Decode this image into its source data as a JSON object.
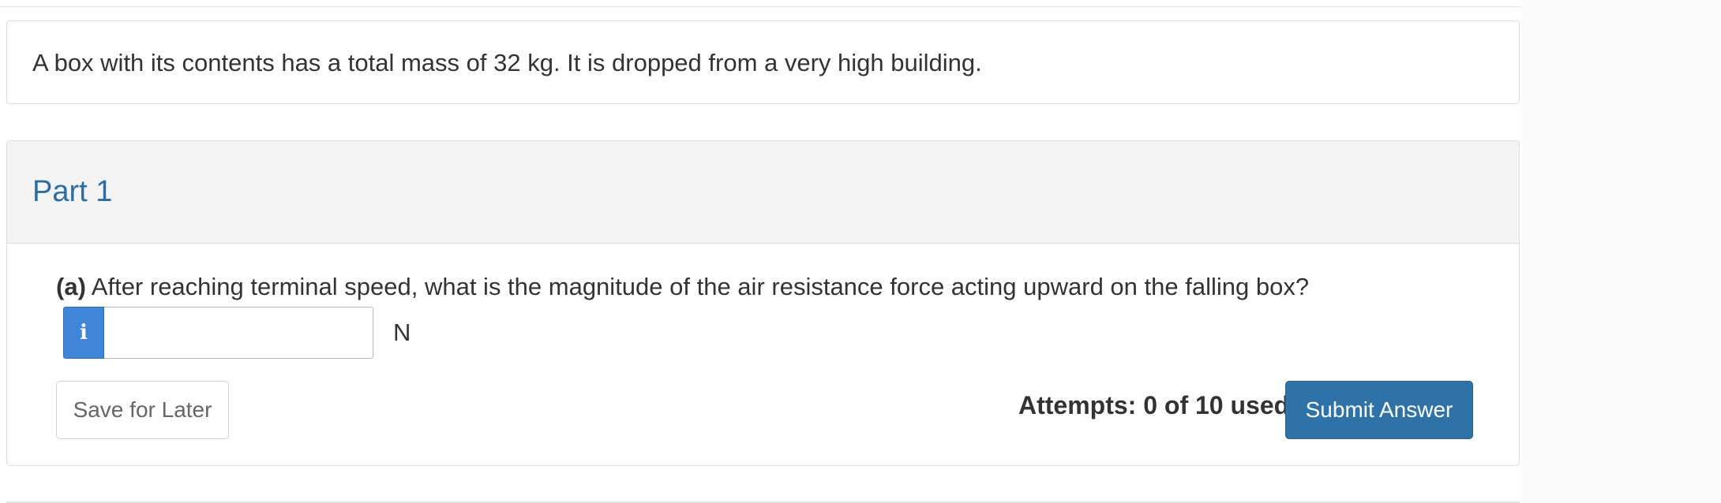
{
  "problem": {
    "stem": "A box with its contents has a total mass of 32 kg. It is dropped from a very high building."
  },
  "part": {
    "title": "Part 1",
    "question_label": "(a)",
    "question_text": " After reaching terminal speed, what is the magnitude of the air resistance force acting upward on the falling box?",
    "info_icon": "i",
    "answer_value": "",
    "answer_placeholder": "",
    "unit": "N",
    "save_label": "Save for Later",
    "attempts_text": "Attempts: 0 of 10 used",
    "submit_label": "Submit Answer"
  },
  "colors": {
    "accent": "#2f72a8",
    "info_button": "#3f86d8",
    "part_title": "#2c6ea1"
  }
}
